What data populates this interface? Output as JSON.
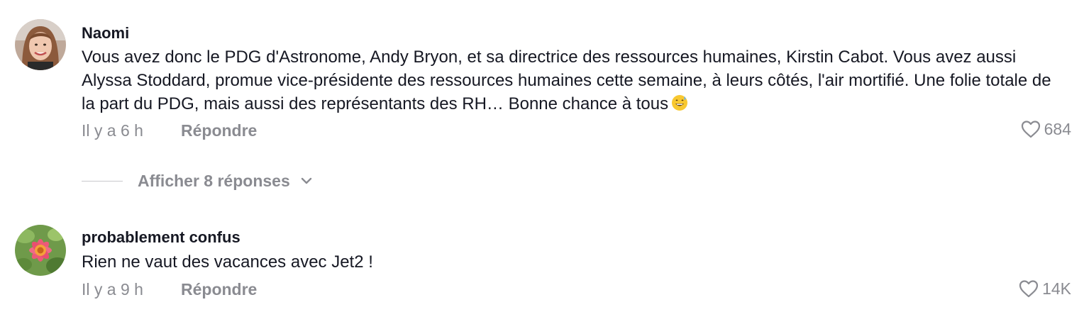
{
  "comments": [
    {
      "username": "Naomi",
      "text": "Vous avez donc le PDG d'Astronome, Andy Bryon, et sa directrice des ressources humaines, Kirstin Cabot. Vous avez aussi Alyssa Stoddard, promue vice-présidente des ressources humaines cette semaine, à leurs côtés, l'air mortifié. Une folie totale de la part du PDG, mais aussi des représentants des RH… Bonne chance à tous",
      "emoji": "grinning-sweat-emoji",
      "time": "Il y a 6 h",
      "reply_label": "Répondre",
      "likes": "684",
      "like_icon": "heart-outline-icon",
      "view_replies_label": "Afficher 8 réponses",
      "view_replies_icon": "chevron-down-icon"
    },
    {
      "username": "probablement confus",
      "text": "Rien ne vaut des vacances avec Jet2 !",
      "time": "Il y a 9 h",
      "reply_label": "Répondre",
      "likes": "14K",
      "like_icon": "heart-outline-icon"
    }
  ],
  "colors": {
    "primary_text": "#161823",
    "secondary_text": "#8a8b91",
    "divider": "#c8c8cc"
  }
}
